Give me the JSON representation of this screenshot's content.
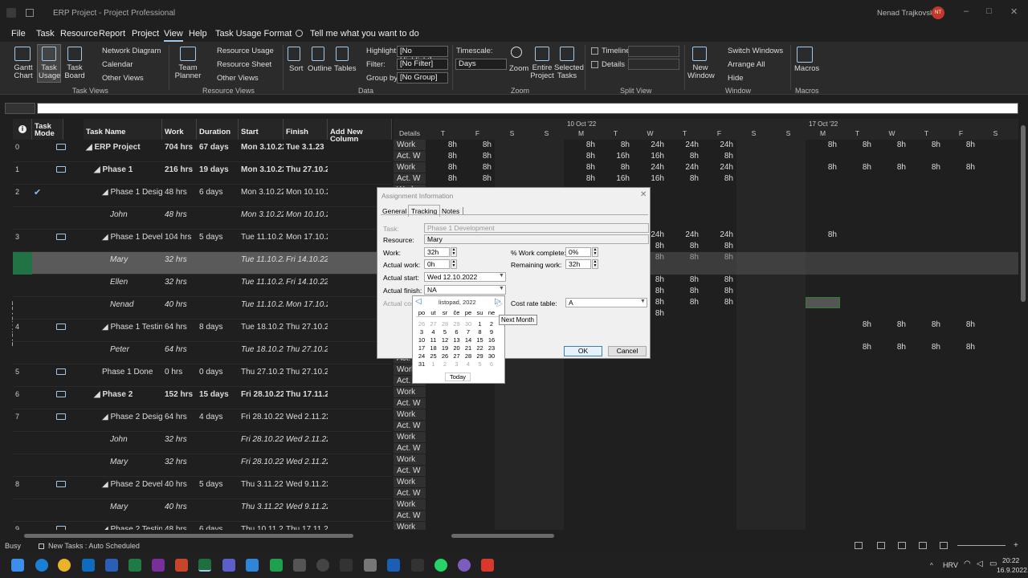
{
  "window": {
    "title": "ERP Project - Project Professional",
    "user": "Nenad Trajkovski",
    "user_initials": "NT"
  },
  "menu": [
    "File",
    "Task",
    "Resource",
    "Report",
    "Project",
    "View",
    "Help",
    "Task Usage Format"
  ],
  "tell_me": "Tell me what you want to do",
  "ribbon": {
    "gantt_chart": "Gantt Chart",
    "task_usage": "Task Usage",
    "task_board": "Task Board",
    "network_diagram": "Network Diagram",
    "calendar": "Calendar",
    "other_views": "Other Views",
    "team_planner": "Team Planner",
    "resource_usage": "Resource Usage",
    "resource_sheet": "Resource Sheet",
    "other_views2": "Other Views",
    "sort": "Sort",
    "outline": "Outline",
    "tables": "Tables",
    "highlight_label": "Highlight:",
    "highlight_value": "[No Highlight]",
    "filter_label": "Filter:",
    "filter_value": "[No Filter]",
    "group_label": "Group by:",
    "group_value": "[No Group]",
    "timescale_label": "Timescale:",
    "timescale_value": "Days",
    "zoom": "Zoom",
    "entire_project": "Entire Project",
    "selected_tasks": "Selected Tasks",
    "timeline": "Timeline",
    "details": "Details",
    "new_window": "New Window",
    "switch_windows": "Switch Windows",
    "arrange_all": "Arrange All",
    "hide": "Hide",
    "macros": "Macros",
    "groups": [
      "Task Views",
      "Resource Views",
      "Data",
      "Zoom",
      "Split View",
      "Window",
      "Macros"
    ]
  },
  "sidebar_label": "TASK USAGE",
  "columns": [
    "Task Mode",
    "Task Name",
    "Work",
    "Duration",
    "Start",
    "Finish",
    "Add New Column"
  ],
  "rows": [
    {
      "id": "0",
      "name": "ERP Project",
      "work": "704 hrs",
      "duration": "67 days",
      "start": "Mon 3.10.22",
      "finish": "Tue 3.1.23",
      "bold": true,
      "indent": 0,
      "summary": true,
      "icon": true
    },
    {
      "id": "1",
      "name": "Phase 1",
      "work": "216 hrs",
      "duration": "19 days",
      "start": "Mon 3.10.22",
      "finish": "Thu 27.10.22",
      "bold": true,
      "indent": 1,
      "summary": true,
      "icon": true
    },
    {
      "id": "2",
      "name": "Phase 1 Design",
      "work": "48 hrs",
      "duration": "6 days",
      "start": "Mon 3.10.22",
      "finish": "Mon 10.10.22",
      "bold": false,
      "indent": 2,
      "summary": true,
      "icon": false,
      "check": true
    },
    {
      "id": "",
      "name": "John",
      "work": "48 hrs",
      "duration": "",
      "start": "Mon 3.10.22",
      "finish": "Mon 10.10.22",
      "italic": true,
      "indent": 3
    },
    {
      "id": "3",
      "name": "Phase 1 Develop",
      "work": "104 hrs",
      "duration": "5 days",
      "start": "Tue 11.10.22",
      "finish": "Mon 17.10.22",
      "indent": 2,
      "summary": true,
      "icon": true
    },
    {
      "id": "",
      "name": "Mary",
      "work": "32 hrs",
      "duration": "",
      "start": "Tue 11.10.22",
      "finish": "Fri 14.10.22",
      "italic": true,
      "indent": 3,
      "selected": true
    },
    {
      "id": "",
      "name": "Ellen",
      "work": "32 hrs",
      "duration": "",
      "start": "Tue 11.10.22",
      "finish": "Fri 14.10.22",
      "italic": true,
      "indent": 3
    },
    {
      "id": "",
      "name": "Nenad",
      "work": "40 hrs",
      "duration": "",
      "start": "Tue 11.10.22",
      "finish": "Mon 17.10.22",
      "italic": true,
      "indent": 3
    },
    {
      "id": "4",
      "name": "Phase 1 Testing",
      "work": "64 hrs",
      "duration": "8 days",
      "start": "Tue 18.10.22",
      "finish": "Thu 27.10.22",
      "indent": 2,
      "summary": true,
      "icon": true
    },
    {
      "id": "",
      "name": "Peter",
      "work": "64 hrs",
      "duration": "",
      "start": "Tue 18.10.22",
      "finish": "Thu 27.10.22",
      "italic": true,
      "indent": 3
    },
    {
      "id": "5",
      "name": "Phase 1 Done",
      "work": "0 hrs",
      "duration": "0 days",
      "start": "Thu 27.10.22",
      "finish": "Thu 27.10.22",
      "indent": 2,
      "icon": true
    },
    {
      "id": "6",
      "name": "Phase 2",
      "work": "152 hrs",
      "duration": "15 days",
      "start": "Fri 28.10.22",
      "finish": "Thu 17.11.22",
      "bold": true,
      "indent": 1,
      "summary": true,
      "icon": true
    },
    {
      "id": "7",
      "name": "Phase 2 Design",
      "work": "64 hrs",
      "duration": "4 days",
      "start": "Fri 28.10.22",
      "finish": "Wed 2.11.22",
      "indent": 2,
      "summary": true,
      "icon": true
    },
    {
      "id": "",
      "name": "John",
      "work": "32 hrs",
      "duration": "",
      "start": "Fri 28.10.22",
      "finish": "Wed 2.11.22",
      "italic": true,
      "indent": 3
    },
    {
      "id": "",
      "name": "Mary",
      "work": "32 hrs",
      "duration": "",
      "start": "Fri 28.10.22",
      "finish": "Wed 2.11.22",
      "italic": true,
      "indent": 3
    },
    {
      "id": "8",
      "name": "Phase 2 Develop",
      "work": "40 hrs",
      "duration": "5 days",
      "start": "Thu 3.11.22",
      "finish": "Wed 9.11.22",
      "indent": 2,
      "summary": true,
      "icon": true
    },
    {
      "id": "",
      "name": "Mary",
      "work": "40 hrs",
      "duration": "",
      "start": "Thu 3.11.22",
      "finish": "Wed 9.11.22",
      "italic": true,
      "indent": 3
    },
    {
      "id": "9",
      "name": "Phase 2 Testing",
      "work": "48 hrs",
      "duration": "6 days",
      "start": "Thu 10.11.22",
      "finish": "Thu 17.11.22",
      "indent": 2,
      "summary": true,
      "icon": true
    }
  ],
  "timescale": {
    "weeks": [
      "10 Oct '22",
      "17 Oct '22"
    ],
    "days": [
      "Details",
      "T",
      "F",
      "S",
      "S",
      "M",
      "T",
      "W",
      "T",
      "F",
      "S",
      "S",
      "M",
      "T",
      "W",
      "T",
      "F",
      "S"
    ],
    "details": [
      "Work",
      "Act. W"
    ]
  },
  "grid_rows": [
    {
      "w": [
        "8h",
        "8h",
        "",
        "",
        "8h",
        "8h",
        "24h",
        "24h",
        "24h",
        "",
        "",
        "8h",
        "8h",
        "8h",
        "8h",
        "8h",
        ""
      ],
      "a": [
        "8h",
        "8h",
        "",
        "",
        "8h",
        "16h",
        "16h",
        "8h",
        "8h",
        "",
        "",
        "",
        "",
        "",
        "",
        "",
        ""
      ]
    },
    {
      "w": [
        "8h",
        "8h",
        "",
        "",
        "8h",
        "8h",
        "24h",
        "24h",
        "24h",
        "",
        "",
        "8h",
        "8h",
        "8h",
        "8h",
        "8h",
        ""
      ],
      "a": [
        "8h",
        "8h",
        "",
        "",
        "8h",
        "16h",
        "16h",
        "8h",
        "8h",
        "",
        "",
        "",
        "",
        "",
        "",
        "",
        ""
      ]
    },
    {
      "w": [
        "",
        "",
        "",
        "",
        "",
        "",
        "",
        "",
        "",
        "",
        "",
        "",
        "",
        "",
        "",
        "",
        ""
      ],
      "a": [
        "",
        "",
        "",
        "",
        "",
        "",
        "",
        "",
        "",
        "",
        "",
        "",
        "",
        "",
        "",
        "",
        ""
      ]
    },
    {
      "w": [
        "",
        "",
        "",
        "",
        "",
        "",
        "",
        "",
        "",
        "",
        "",
        "",
        "",
        "",
        "",
        "",
        ""
      ],
      "a": [
        "",
        "",
        "",
        "",
        "",
        "",
        "",
        "",
        "",
        "",
        "",
        "",
        "",
        "",
        "",
        "",
        ""
      ]
    },
    {
      "w": [
        "",
        "",
        "",
        "",
        "",
        "",
        "24h",
        "24h",
        "24h",
        "",
        "",
        "8h",
        "",
        "",
        "",
        "",
        ""
      ],
      "a": [
        "",
        "",
        "",
        "",
        "",
        "",
        "8h",
        "8h",
        "8h",
        "",
        "",
        "",
        "",
        "",
        "",
        "",
        ""
      ]
    },
    {
      "w": [
        "",
        "",
        "",
        "",
        "",
        "",
        "8h",
        "8h",
        "8h",
        "",
        "",
        "",
        "",
        "",
        "",
        "",
        ""
      ],
      "a": [
        "",
        "",
        "",
        "",
        "",
        "",
        "",
        "",
        "",
        "",
        "",
        "",
        "",
        "",
        "",
        "",
        ""
      ]
    },
    {
      "w": [
        "",
        "",
        "",
        "",
        "",
        "",
        "8h",
        "8h",
        "8h",
        "",
        "",
        "",
        "",
        "",
        "",
        "",
        ""
      ],
      "a": [
        "",
        "",
        "",
        "",
        "",
        "",
        "8h",
        "8h",
        "8h",
        "",
        "",
        "",
        "",
        "",
        "",
        "",
        ""
      ]
    },
    {
      "w": [
        "",
        "",
        "",
        "",
        "",
        "",
        "8h",
        "8h",
        "8h",
        "",
        "",
        "8h",
        "",
        "",
        "",
        "",
        ""
      ],
      "a": [
        "",
        "",
        "",
        "",
        "",
        "",
        "8h",
        "",
        "",
        "",
        "",
        "",
        "",
        "",
        "",
        "",
        ""
      ]
    },
    {
      "w": [
        "",
        "",
        "",
        "",
        "",
        "",
        "",
        "",
        "",
        "",
        "",
        "",
        "8h",
        "8h",
        "8h",
        "8h",
        ""
      ],
      "a": [
        "",
        "",
        "",
        "",
        "",
        "",
        "",
        "",
        "",
        "",
        "",
        "",
        "",
        "",
        "",
        "",
        ""
      ]
    },
    {
      "w": [
        "",
        "",
        "",
        "",
        "",
        "",
        "",
        "",
        "",
        "",
        "",
        "",
        "8h",
        "8h",
        "8h",
        "8h",
        ""
      ],
      "a": [
        "",
        "",
        "",
        "",
        "",
        "",
        "",
        "",
        "",
        "",
        "",
        "",
        "",
        "",
        "",
        "",
        ""
      ]
    }
  ],
  "dialog": {
    "title": "Assignment Information",
    "tabs": [
      "General",
      "Tracking",
      "Notes"
    ],
    "task_label": "Task:",
    "task_value": "Phase 1 Development",
    "resource_label": "Resource:",
    "resource_value": "Mary",
    "work_label": "Work:",
    "work_value": "32h",
    "actual_work_label": "Actual work:",
    "actual_work_value": "0h",
    "actual_start_label": "Actual start:",
    "actual_start_value": "Wed 12.10.2022",
    "actual_finish_label": "Actual finish:",
    "actual_finish_value": "NA",
    "actual_cost_label": "Actual cost:",
    "pct_label": "% Work complete:",
    "pct_value": "0%",
    "remaining_label": "Remaining work:",
    "remaining_value": "32h",
    "cost_rate_label": "Cost rate table:",
    "cost_rate_value": "A",
    "ok": "OK",
    "cancel": "Cancel"
  },
  "calendar": {
    "month": "listopad, 2022",
    "tooltip": "Next Month",
    "weekdays": [
      "po",
      "ut",
      "sr",
      "če",
      "pe",
      "su",
      "ne"
    ],
    "weeks": [
      [
        "26",
        "27",
        "28",
        "29",
        "30",
        "1",
        "2"
      ],
      [
        "3",
        "4",
        "5",
        "6",
        "7",
        "8",
        "9"
      ],
      [
        "10",
        "11",
        "12",
        "13",
        "14",
        "15",
        "16"
      ],
      [
        "17",
        "18",
        "19",
        "20",
        "21",
        "22",
        "23"
      ],
      [
        "24",
        "25",
        "26",
        "27",
        "28",
        "29",
        "30"
      ],
      [
        "31",
        "1",
        "2",
        "3",
        "4",
        "5",
        "6"
      ]
    ],
    "today": "Today"
  },
  "status": {
    "mode": "Busy",
    "new_tasks": "New Tasks : Auto Scheduled"
  },
  "taskbar": {
    "lang": "HRV",
    "time": "20:22",
    "date": "16.9.2022."
  },
  "colors": {
    "accent": "#217346",
    "selected_row": "#5a5a5a",
    "dialog_bg": "#f0f0f0",
    "link": "#2e7d32"
  }
}
